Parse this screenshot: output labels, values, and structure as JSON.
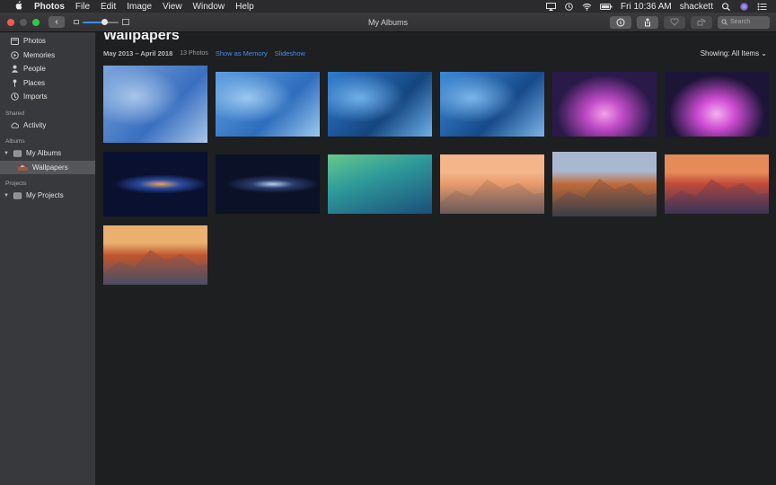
{
  "menubar": {
    "app_name": "Photos",
    "menus": [
      "File",
      "Edit",
      "Image",
      "View",
      "Window",
      "Help"
    ],
    "clock": "Fri 10:36 AM",
    "user": "shackett",
    "status_icons": [
      "airplay-icon",
      "time-machine-icon",
      "wifi-icon",
      "battery-icon",
      "spotlight-icon",
      "siri-icon",
      "notification-center-icon"
    ]
  },
  "window": {
    "title": "My Albums",
    "search_placeholder": "Search",
    "zoom_level": 0.6,
    "colors": {
      "close": "#fc5753",
      "minimize": "#5a5a5c",
      "maximize": "#33c748",
      "accent": "#3d90f2"
    }
  },
  "sidebar": {
    "library": [
      {
        "label": "Photos",
        "icon": "photos-icon"
      },
      {
        "label": "Memories",
        "icon": "memories-icon"
      },
      {
        "label": "People",
        "icon": "people-icon"
      },
      {
        "label": "Places",
        "icon": "places-icon"
      },
      {
        "label": "Imports",
        "icon": "imports-icon"
      }
    ],
    "shared_heading": "Shared",
    "shared_items": [
      {
        "label": "Activity",
        "icon": "cloud-icon"
      }
    ],
    "albums_heading": "Albums",
    "my_albums": "My Albums",
    "wallpapers": "Wallpapers",
    "projects_heading": "Projects",
    "my_projects": "My Projects"
  },
  "album": {
    "title": "Wallpapers",
    "date_range": "May 2013 – April 2018",
    "photo_count": "13 Photos",
    "show_as_memory": "Show as Memory",
    "slideshow": "Slideshow",
    "showing_label": "Showing:",
    "showing_value": "All Items"
  },
  "photos": [
    {
      "name": "mountain-lion-wallpaper",
      "colors": [
        "#7aa4da",
        "#3a6fc0",
        "#a9c6ea"
      ]
    },
    {
      "name": "lion-wallpaper",
      "colors": [
        "#5f9fe0",
        "#2e6dbd",
        "#9bc9f0"
      ]
    },
    {
      "name": "mavericks-blue-wallpaper",
      "colors": [
        "#2f7ccf",
        "#14457f",
        "#6fb0ea"
      ]
    },
    {
      "name": "blue-wave-wallpaper",
      "colors": [
        "#3d8ad8",
        "#164a8a",
        "#7bb5ea"
      ]
    },
    {
      "name": "aurora-purple-wallpaper",
      "colors": [
        "#c04ac7",
        "#2a1a4a",
        "#f2a0e8"
      ]
    },
    {
      "name": "aurora-magenta-wallpaper",
      "colors": [
        "#d04cd4",
        "#1c1538",
        "#f4b2ef"
      ]
    },
    {
      "name": "andromeda-galaxy-wallpaper",
      "colors": [
        "#2a4ba0",
        "#0a1030",
        "#e7a25e"
      ]
    },
    {
      "name": "galaxy-blue-wallpaper",
      "colors": [
        "#2c3c70",
        "#0b1228",
        "#b8cfee"
      ]
    },
    {
      "name": "mavericks-wave-wallpaper",
      "colors": [
        "#2f9a9a",
        "#1b4e7a",
        "#67c98c"
      ]
    },
    {
      "name": "yosemite-wallpaper",
      "colors": [
        "#e89a6a",
        "#6a5a5a",
        "#f3b58a"
      ]
    },
    {
      "name": "el-capitan-wallpaper",
      "colors": [
        "#c06a3a",
        "#3a3e48",
        "#aab8cf"
      ]
    },
    {
      "name": "sierra-wallpaper",
      "colors": [
        "#c04a3a",
        "#3a3458",
        "#e78a5a"
      ]
    },
    {
      "name": "high-sierra-wallpaper",
      "colors": [
        "#c2562e",
        "#4a4e64",
        "#e9b070"
      ]
    }
  ]
}
